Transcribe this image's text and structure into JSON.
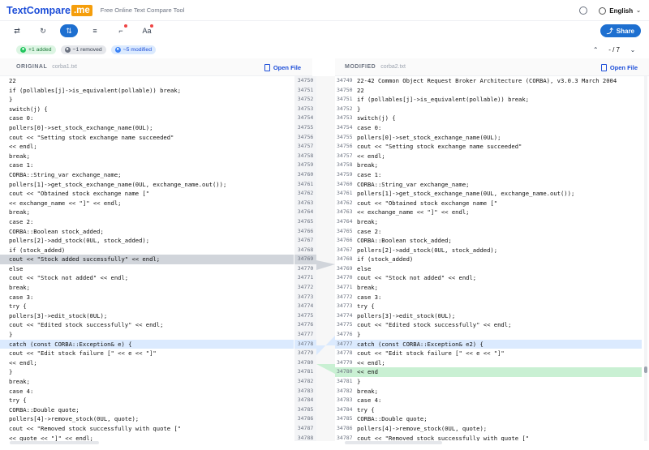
{
  "header": {
    "logo_text": "TextCompare",
    "logo_suffix": ".me",
    "tagline": "Free Online Text Compare Tool",
    "language": "English"
  },
  "toolbar": {
    "share_label": "Share",
    "aa_label": "Aa"
  },
  "badges": {
    "added": "+1 added",
    "removed": "−1 removed",
    "modified": "~5 modified"
  },
  "navigation": {
    "position": "- / 7"
  },
  "left_panel": {
    "title": "ORIGINAL",
    "filename": "corba1.txt",
    "open_file": "Open File",
    "lines": [
      {
        "num": "34750",
        "text": "22",
        "hl": ""
      },
      {
        "num": "34751",
        "text": "if (pollables[j]->is_equivalent(pollable)) break;",
        "hl": ""
      },
      {
        "num": "34752",
        "text": "}",
        "hl": ""
      },
      {
        "num": "34753",
        "text": "switch(j) {",
        "hl": ""
      },
      {
        "num": "34754",
        "text": "case 0:",
        "hl": ""
      },
      {
        "num": "34755",
        "text": "pollers[0]->set_stock_exchange_name(0UL);",
        "hl": ""
      },
      {
        "num": "34756",
        "text": "cout << \"Setting stock exchange name succeeded\"",
        "hl": ""
      },
      {
        "num": "34757",
        "text": "<< endl;",
        "hl": ""
      },
      {
        "num": "34758",
        "text": "break;",
        "hl": ""
      },
      {
        "num": "34759",
        "text": "case 1:",
        "hl": ""
      },
      {
        "num": "34760",
        "text": "CORBA::String_var exchange_name;",
        "hl": ""
      },
      {
        "num": "34761",
        "text": "pollers[1]->get_stock_exchange_name(0UL, exchange_name.out());",
        "hl": ""
      },
      {
        "num": "34762",
        "text": "cout << \"Obtained stock exchange name [\"",
        "hl": ""
      },
      {
        "num": "34763",
        "text": "<< exchange_name << \"]\" << endl;",
        "hl": ""
      },
      {
        "num": "34764",
        "text": "break;",
        "hl": ""
      },
      {
        "num": "34765",
        "text": "case 2:",
        "hl": ""
      },
      {
        "num": "34766",
        "text": "CORBA::Boolean stock_added;",
        "hl": ""
      },
      {
        "num": "34767",
        "text": "pollers[2]->add_stock(0UL, stock_added);",
        "hl": ""
      },
      {
        "num": "34768",
        "text": "if (stock_added)",
        "hl": ""
      },
      {
        "num": "34769",
        "text": "cout << \"Stock added successfully\" << endl;",
        "hl": "gray"
      },
      {
        "num": "34770",
        "text": "else",
        "hl": ""
      },
      {
        "num": "34771",
        "text": "cout << \"Stock not added\" << endl;",
        "hl": ""
      },
      {
        "num": "34772",
        "text": "break;",
        "hl": ""
      },
      {
        "num": "34773",
        "text": "case 3:",
        "hl": ""
      },
      {
        "num": "34774",
        "text": "try {",
        "hl": ""
      },
      {
        "num": "34775",
        "text": "pollers[3]->edit_stock(0UL);",
        "hl": ""
      },
      {
        "num": "34776",
        "text": "cout << \"Edited stock successfully\" << endl;",
        "hl": ""
      },
      {
        "num": "34777",
        "text": "}",
        "hl": ""
      },
      {
        "num": "34778",
        "text": "catch (const CORBA::Exception& e) {",
        "hl": "blue"
      },
      {
        "num": "34779",
        "text": "cout << \"Edit stock failure [\" << e << \"]\"",
        "hl": ""
      },
      {
        "num": "34780",
        "text": "<< endl;",
        "hl": ""
      },
      {
        "num": "34781",
        "text": "}",
        "hl": ""
      },
      {
        "num": "34782",
        "text": "break;",
        "hl": ""
      },
      {
        "num": "34783",
        "text": "case 4:",
        "hl": ""
      },
      {
        "num": "34784",
        "text": "try {",
        "hl": ""
      },
      {
        "num": "34785",
        "text": "CORBA::Double quote;",
        "hl": ""
      },
      {
        "num": "34786",
        "text": "pollers[4]->remove_stock(0UL, quote);",
        "hl": ""
      },
      {
        "num": "34787",
        "text": "cout << \"Removed stock successfully with quote [\"",
        "hl": ""
      },
      {
        "num": "34788",
        "text": "<< quote << \"]\" << endl;",
        "hl": ""
      }
    ]
  },
  "right_panel": {
    "title": "MODIFIED",
    "filename": "corba2.txt",
    "open_file": "Open File",
    "lines": [
      {
        "num": "34749",
        "text": "22-42 Common Object Request Broker Architecture (CORBA), v3.0.3 March 2004",
        "hl": ""
      },
      {
        "num": "34750",
        "text": "22",
        "hl": ""
      },
      {
        "num": "34751",
        "text": "if (pollables[j]->is_equivalent(pollable)) break;",
        "hl": ""
      },
      {
        "num": "34752",
        "text": "}",
        "hl": ""
      },
      {
        "num": "34753",
        "text": "switch(j) {",
        "hl": ""
      },
      {
        "num": "34754",
        "text": "case 0:",
        "hl": ""
      },
      {
        "num": "34755",
        "text": "pollers[0]->set_stock_exchange_name(0UL);",
        "hl": ""
      },
      {
        "num": "34756",
        "text": "cout << \"Setting stock exchange name succeeded\"",
        "hl": ""
      },
      {
        "num": "34757",
        "text": "<< endl;",
        "hl": ""
      },
      {
        "num": "34758",
        "text": "break;",
        "hl": ""
      },
      {
        "num": "34759",
        "text": "case 1:",
        "hl": ""
      },
      {
        "num": "34760",
        "text": "CORBA::String_var exchange_name;",
        "hl": ""
      },
      {
        "num": "34761",
        "text": "pollers[1]->get_stock_exchange_name(0UL, exchange_name.out());",
        "hl": ""
      },
      {
        "num": "34762",
        "text": "cout << \"Obtained stock exchange name [\"",
        "hl": ""
      },
      {
        "num": "34763",
        "text": "<< exchange_name << \"]\" << endl;",
        "hl": ""
      },
      {
        "num": "34764",
        "text": "break;",
        "hl": ""
      },
      {
        "num": "34765",
        "text": "case 2:",
        "hl": ""
      },
      {
        "num": "34766",
        "text": "CORBA::Boolean stock_added;",
        "hl": ""
      },
      {
        "num": "34767",
        "text": "pollers[2]->add_stock(0UL, stock_added);",
        "hl": ""
      },
      {
        "num": "34768",
        "text": "if (stock_added)",
        "hl": ""
      },
      {
        "num": "34769",
        "text": "else",
        "hl": ""
      },
      {
        "num": "34770",
        "text": "cout << \"Stock not added\" << endl;",
        "hl": ""
      },
      {
        "num": "34771",
        "text": "break;",
        "hl": ""
      },
      {
        "num": "34772",
        "text": "case 3:",
        "hl": ""
      },
      {
        "num": "34773",
        "text": "try {",
        "hl": ""
      },
      {
        "num": "34774",
        "text": "pollers[3]->edit_stock(0UL);",
        "hl": ""
      },
      {
        "num": "34775",
        "text": "cout << \"Edited stock successfully\" << endl;",
        "hl": ""
      },
      {
        "num": "34776",
        "text": "}",
        "hl": ""
      },
      {
        "num": "34777",
        "text": "catch (const CORBA::Exception& e2) {",
        "hl": "blue"
      },
      {
        "num": "34778",
        "text": "cout << \"Edit stock failure [\" << e << \"]\"",
        "hl": ""
      },
      {
        "num": "34779",
        "text": "<< endl;",
        "hl": ""
      },
      {
        "num": "34780",
        "text": "<< end",
        "hl": "green"
      },
      {
        "num": "34781",
        "text": "}",
        "hl": ""
      },
      {
        "num": "34782",
        "text": "break;",
        "hl": ""
      },
      {
        "num": "34783",
        "text": "case 4:",
        "hl": ""
      },
      {
        "num": "34784",
        "text": "try {",
        "hl": ""
      },
      {
        "num": "34785",
        "text": "CORBA::Double quote;",
        "hl": ""
      },
      {
        "num": "34786",
        "text": "pollers[4]->remove_stock(0UL, quote);",
        "hl": ""
      },
      {
        "num": "34787",
        "text": "cout << \"Removed stock successfully with quote [\"",
        "hl": ""
      }
    ]
  }
}
